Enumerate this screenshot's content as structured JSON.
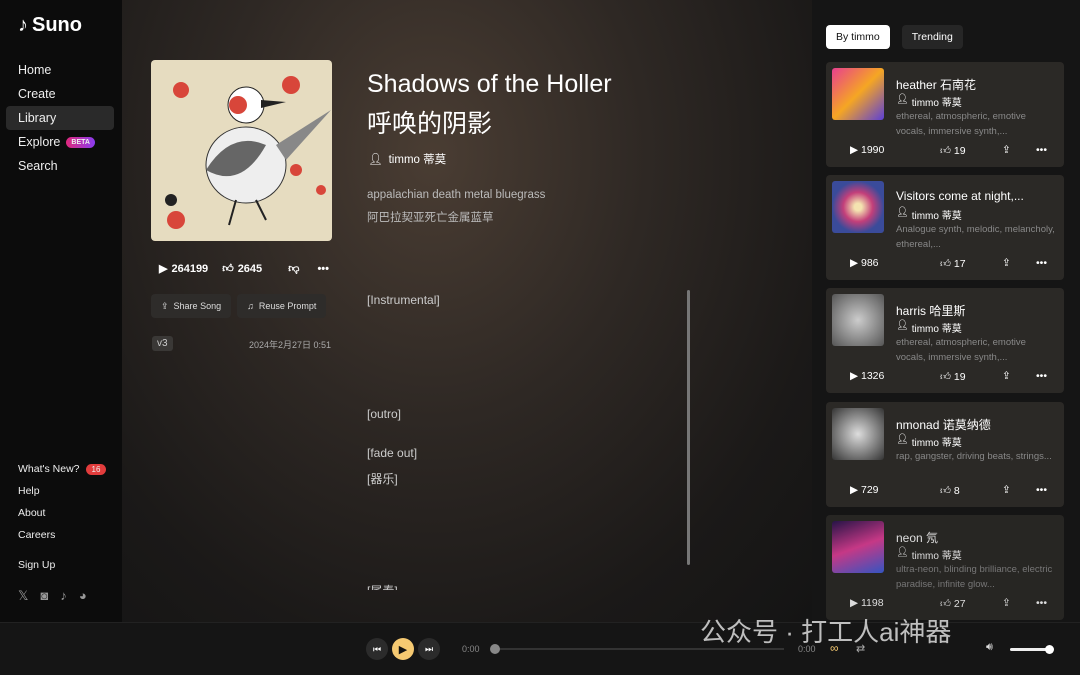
{
  "brand": "Suno",
  "nav": [
    {
      "label": "Home"
    },
    {
      "label": "Create"
    },
    {
      "label": "Library",
      "active": true
    },
    {
      "label": "Explore",
      "badge": "BETA"
    },
    {
      "label": "Search"
    }
  ],
  "bottom_nav": {
    "whats_new": "What's New?",
    "whats_new_count": "16",
    "help": "Help",
    "about": "About",
    "careers": "Careers",
    "sign_up": "Sign Up"
  },
  "socials": [
    "x-icon",
    "instagram-icon",
    "tiktok-icon",
    "discord-icon"
  ],
  "song": {
    "title": "Shadows of the Holler 呼唤的阴影",
    "author": "timmo 蒂莫",
    "style": "appalachian death metal bluegrass",
    "style_cn": "阿巴拉契亚死亡金属蓝草",
    "plays": "264199",
    "likes": "2645",
    "share_label": "Share Song",
    "reuse_label": "Reuse Prompt",
    "version": "v3",
    "date": "2024年2月27日 0:51",
    "lyrics": [
      "[Instrumental]",
      "[outro]",
      "[fade out]",
      "[器乐]",
      "[尾奏]"
    ]
  },
  "tabs": [
    {
      "label": "By timmo",
      "active": true
    },
    {
      "label": "Trending"
    }
  ],
  "cards": [
    {
      "title": "heather  石南花",
      "author": "timmo 蒂莫",
      "desc": "ethereal, atmospheric, emotive vocals, immersive synth,...",
      "plays": "1990",
      "likes": "19"
    },
    {
      "title": "Visitors come at night,...",
      "author": "timmo 蒂莫",
      "desc": "Analogue synth, melodic, melancholy, ethereal,...",
      "plays": "986",
      "likes": "17"
    },
    {
      "title": "harris  哈里斯",
      "author": "timmo 蒂莫",
      "desc": "ethereal, atmospheric, emotive vocals, immersive synth,...",
      "plays": "1326",
      "likes": "19"
    },
    {
      "title": "nmonad  诺莫纳德",
      "author": "timmo 蒂莫",
      "desc": "rap, gangster, driving beats, strings...",
      "plays": "729",
      "likes": "8"
    },
    {
      "title": "neon  氖",
      "author": "timmo 蒂莫",
      "desc": "ultra-neon, blinding brilliance, electric paradise, infinite glow...",
      "plays": "1198",
      "likes": "27"
    }
  ],
  "player": {
    "current_time": "0:00",
    "duration": "0:00",
    "progress": 0,
    "volume": 1.0,
    "accent": "#f5c971"
  },
  "watermark": "公众号 · 打工人ai神器"
}
